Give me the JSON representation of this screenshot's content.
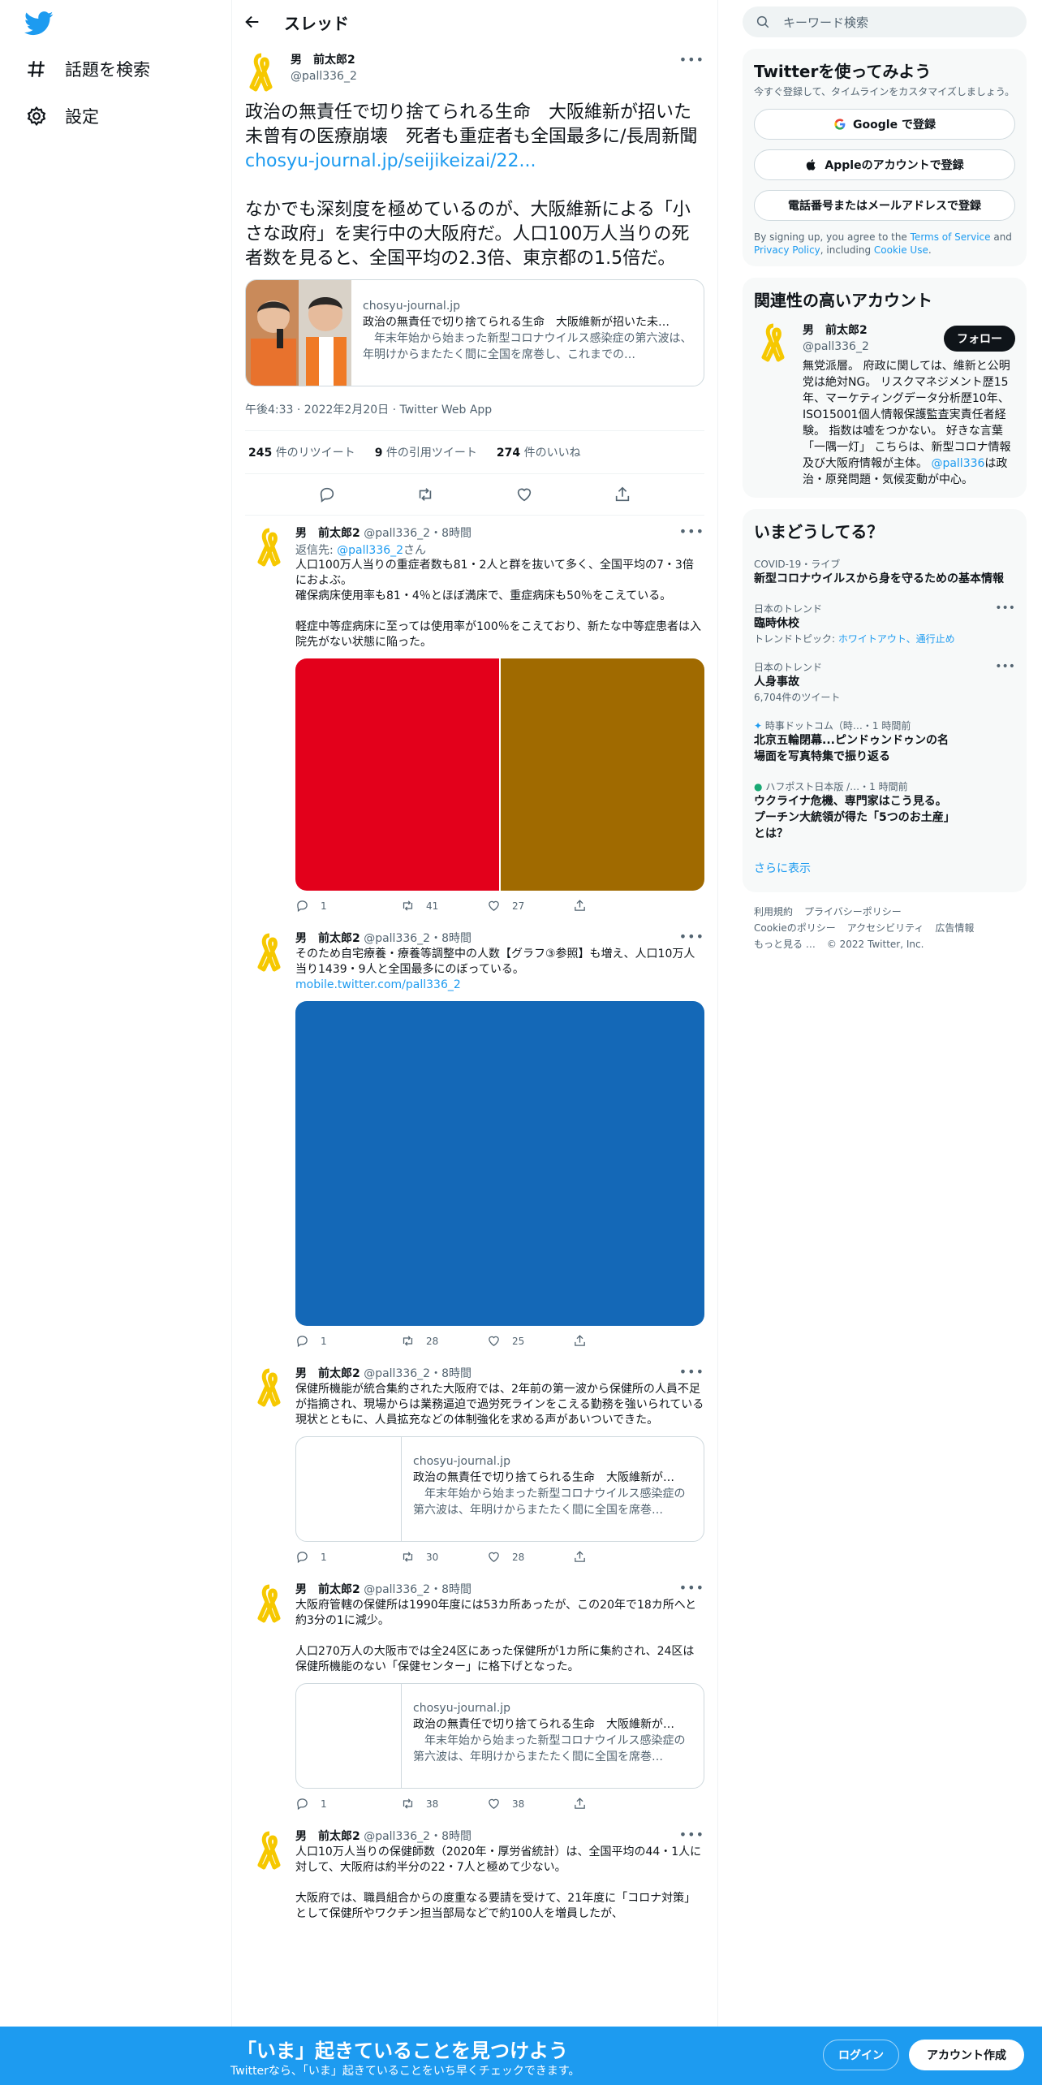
{
  "nav": {
    "explore_label": "話題を検索",
    "settings_label": "設定"
  },
  "header": {
    "title": "スレッド"
  },
  "main_tweet": {
    "display_name": "男　前太郎2",
    "handle": "@pall336_2",
    "text": "政治の無責任で切り捨てられる生命　大阪維新が招いた未曾有の医療崩壊　死者も重症者も全国最多に/長周新聞",
    "link": "chosyu-journal.jp/seijikeizai/22...",
    "text2": "なかでも深刻度を極めているのが、大阪維新による「小さな政府」を実行中の大阪府だ。人口100万人当りの死者数を見ると、全国平均の2.3倍、東京都の1.5倍だ。",
    "card": {
      "domain": "chosyu-journal.jp",
      "title": "政治の無責任で切り捨てられる生命　大阪維新が招いた未…",
      "desc": "　年末年始から始まった新型コロナウイルス感染症の第六波は、年明けからまたたく間に全国を席巻し、これまでの…"
    },
    "timestamp": "午後4:33 · 2022年2月20日 · Twitter Web App",
    "retweets_count": "245",
    "retweets_label": "件のリツイート",
    "quotes_count": "9",
    "quotes_label": "件の引用ツイート",
    "likes_count": "274",
    "likes_label": "件のいいね"
  },
  "replies": [
    {
      "display_name": "男　前太郎2",
      "handle_time": "@pall336_2・8時間",
      "reply_to_prefix": "返信先: ",
      "reply_to_handle": "@pall336_2",
      "reply_to_suffix": "さん",
      "text": "人口100万人当りの重症者数も81・2人と群を抜いて多く、全国平均の7・3倍におよぶ。\n確保病床使用率も81・4％とほぼ満床で、重症病床も50％をこえている。\n\n軽症中等症病床に至っては使用率が100％をこえており、新たな中等症患者は入院先がない状態に陥った。",
      "media_colors": [
        "#e3001b",
        "#a06a00"
      ],
      "replies": "1",
      "retweets": "41",
      "likes": "27"
    },
    {
      "display_name": "男　前太郎2",
      "handle_time": "@pall336_2・8時間",
      "text": "そのため自宅療養・療養等調整中の人数【グラフ③参照】も増え、人口10万人当り1439・9人と全国最多にのぼっている。",
      "link": "mobile.twitter.com/pall336_2",
      "media_colors": [
        "#1468b7"
      ],
      "replies": "1",
      "retweets": "28",
      "likes": "25"
    },
    {
      "display_name": "男　前太郎2",
      "handle_time": "@pall336_2・8時間",
      "text": "保健所機能が統合集約された大阪府では、2年前の第一波から保健所の人員不足が指摘され、現場からは業務逼迫で過労死ラインをこえる勤務を強いられている現状とともに、人員拡充などの体制強化を求める声があいついできた。",
      "card": {
        "domain": "chosyu-journal.jp",
        "title": "政治の無責任で切り捨てられる生命　大阪維新が…",
        "desc": "　年末年始から始まった新型コロナウイルス感染症の第六波は、年明けからまたたく間に全国を席巻…"
      },
      "replies": "1",
      "retweets": "30",
      "likes": "28"
    },
    {
      "display_name": "男　前太郎2",
      "handle_time": "@pall336_2・8時間",
      "text": "大阪府管轄の保健所は1990年度には53カ所あったが、この20年で18カ所へと約3分の1に減少。\n\n人口270万人の大阪市では全24区にあった保健所が1カ所に集約され、24区は保健所機能のない「保健センター」に格下げとなった。",
      "card": {
        "domain": "chosyu-journal.jp",
        "title": "政治の無責任で切り捨てられる生命　大阪維新が…",
        "desc": "　年末年始から始まった新型コロナウイルス感染症の第六波は、年明けからまたたく間に全国を席巻…"
      },
      "replies": "1",
      "retweets": "38",
      "likes": "38"
    },
    {
      "display_name": "男　前太郎2",
      "handle_time": "@pall336_2・8時間",
      "text": "人口10万人当りの保健師数（2020年・厚労省統計）は、全国平均の44・1人に対して、大阪府は約半分の22・7人と極めて少ない。\n\n大阪府では、職員組合からの度重なる要請を受けて、21年度に「コロナ対策」として保健所やワクチン担当部局などで約100人を増員したが、"
    }
  ],
  "right": {
    "search_placeholder": "キーワード検索",
    "signup": {
      "title": "Twitterを使ってみよう",
      "subtitle": "今すぐ登録して、タイムラインをカスタマイズしましょう。",
      "google_label": "Google で登録",
      "apple_label": "Appleのアカウントで登録",
      "email_label": "電話番号またはメールアドレスで登録",
      "terms_prefix": "By signing up, you agree to the ",
      "terms_link": "Terms of Service",
      "terms_and": " and ",
      "privacy_link": "Privacy Policy",
      "terms_including": ", including ",
      "cookie_link": "Cookie Use",
      "terms_end": "."
    },
    "relevant": {
      "title": "関連性の高いアカウント",
      "display_name": "男　前太郎2",
      "handle": "@pall336_2",
      "follow_label": "フォロー",
      "bio_1": "無党派層。 府政に関しては、維新と公明党は絶対NG。 リスクマネジメント歴15年、マーケティングデータ分析歴10年、ISO15001個人情報保護監査実責任者経験。 指数は嘘をつかない。 好きな言葉「一隅一灯」 こちらは、新型コロナ情報及び大阪府情報が主体。 ",
      "bio_link": "@pall336",
      "bio_2": "は政治・原発問題・気候変動が中心。"
    },
    "trends": {
      "title": "いまどうしてる？",
      "items": [
        {
          "context": "COVID-19・ライブ",
          "name": "新型コロナウイルスから身を守るための基本情報"
        },
        {
          "context": "日本のトレンド",
          "name": "臨時休校",
          "topics_prefix": "トレンドトピック: ",
          "topics": "ホワイトアウト、通行止め"
        },
        {
          "context": "日本のトレンド",
          "name": "人身事故",
          "sub": "6,704件のツイート"
        },
        {
          "context": "時事ドットコム（時…・1 時間前",
          "name": "北京五輪閉幕...ピンドゥンドゥンの名場面を写真特集で振り返る"
        },
        {
          "context": "ハフポスト日本版 /…・1 時間前",
          "name": "ウクライナ危機、専門家はこう見る。プーチン大統領が得た「5つのお土産」とは？"
        }
      ],
      "show_more": "さらに表示"
    },
    "footer": {
      "terms": "利用規約",
      "privacy": "プライバシーポリシー",
      "cookie": "Cookieのポリシー",
      "accessibility": "アクセシビリティ",
      "ads": "広告情報",
      "more": "もっと見る …",
      "copyright": "© 2022 Twitter, Inc."
    }
  },
  "bottombar": {
    "headline": "「いま」起きていることを見つけよう",
    "sub": "Twitterなら、「いま」起きていることをいち早くチェックできます。",
    "login_label": "ログイン",
    "signup_label": "アカウント作成"
  },
  "colors": {
    "accent": "#1d9bf0",
    "ribbon_yellow": "#f6c800",
    "bottombar": "#1d9bf0"
  }
}
